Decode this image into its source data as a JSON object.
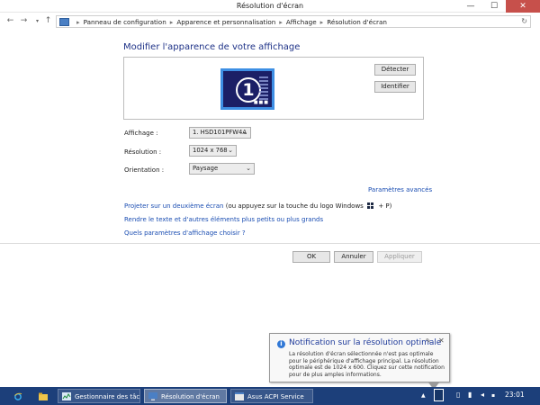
{
  "window": {
    "title": "Résolution d'écran",
    "controls": {
      "minimize": "—",
      "maximize": "☐",
      "close": "✕"
    }
  },
  "navigation": {
    "back": "←",
    "forward": "→",
    "up": "↑",
    "breadcrumb": [
      "Panneau de configuration",
      "Apparence et personnalisation",
      "Affichage",
      "Résolution d'écran"
    ],
    "separator": "▸",
    "refresh": "↻"
  },
  "main": {
    "heading": "Modifier l'apparence de votre affichage",
    "preview": {
      "monitor_number": "1",
      "detect_button": "Détecter",
      "identify_button": "Identifier"
    },
    "display": {
      "label": "Affichage :",
      "value": "1. HSD101PFW4A"
    },
    "resolution": {
      "label": "Résolution :",
      "value": "1024 x 768"
    },
    "orientation": {
      "label": "Orientation :",
      "value": "Paysage"
    },
    "advanced_link": "Paramètres avancés",
    "project_link": "Projeter sur un deuxième écran",
    "project_hint_prefix": "(ou appuyez sur la touche du logo Windows",
    "project_hint_suffix": "+ P)",
    "text_size_link": "Rendre le texte et d'autres éléments plus petits ou plus grands",
    "which_settings_link": "Quels paramètres d'affichage choisir ?"
  },
  "footer": {
    "ok": "OK",
    "cancel": "Annuler",
    "apply": "Appliquer"
  },
  "notification": {
    "title": "Notification sur la résolution optimale",
    "body": "La résolution d'écran sélectionnée n'est pas optimale pour le périphérique d'affichage principal. La résolution optimale est de 1024 x 600. Cliquez sur cette notification pour de plus amples informations."
  },
  "taskbar": {
    "items": [
      "Gestionnaire des tâc...",
      "Résolution d'écran",
      "Asus ACPI Service"
    ],
    "clock": "23:01"
  },
  "colors": {
    "accent": "#1e3287",
    "link": "#1a4db2",
    "taskbar": "#1c3f7a",
    "close_button": "#c7504b"
  }
}
